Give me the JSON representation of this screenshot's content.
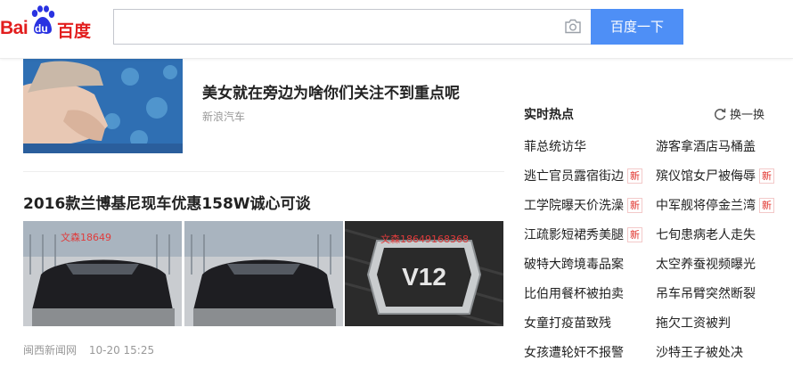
{
  "header": {
    "logo_bai": "Bai",
    "logo_du": "du",
    "logo_cn": "百度",
    "search_value": "",
    "search_button": "百度一下",
    "icons": {
      "camera": "camera-icon"
    }
  },
  "feed": {
    "items": [
      {
        "title": "美女就在旁边为啥你们关注不到重点呢",
        "source": "新浪汽车"
      },
      {
        "title": "2016款兰博基尼现车优惠158W诚心可谈",
        "source": "闽西新闻网",
        "time": "10-20 15:25",
        "thumb_overlays": [
          "文森18649",
          "文森18649168368"
        ]
      }
    ]
  },
  "hot": {
    "title": "实时热点",
    "refresh_label": "换一换",
    "badge_text": "新",
    "items": [
      {
        "text": "菲总统访华",
        "badge": false
      },
      {
        "text": "游客拿酒店马桶盖",
        "badge": false
      },
      {
        "text": "逃亡官员露宿街边",
        "badge": true
      },
      {
        "text": "殡仪馆女尸被侮辱",
        "badge": true
      },
      {
        "text": "工学院曝天价洗澡",
        "badge": true
      },
      {
        "text": "中军舰将停金兰湾",
        "badge": true
      },
      {
        "text": "江疏影短裙秀美腿",
        "badge": true
      },
      {
        "text": "七旬患病老人走失",
        "badge": false
      },
      {
        "text": "破特大跨境毒品案",
        "badge": false
      },
      {
        "text": "太空养蚕视频曝光",
        "badge": false
      },
      {
        "text": "比伯用餐杯被拍卖",
        "badge": false
      },
      {
        "text": "吊车吊臂突然断裂",
        "badge": false
      },
      {
        "text": "女童打疫苗致残",
        "badge": false
      },
      {
        "text": "拖欠工资被判",
        "badge": false
      },
      {
        "text": "女孩遭轮奸不报警",
        "badge": false
      },
      {
        "text": "沙特王子被处决",
        "badge": false
      }
    ]
  },
  "colors": {
    "accent": "#4e8ff6",
    "logo_red": "#e21e1e",
    "logo_blue": "#2932e1",
    "badge_red": "#e0332c"
  }
}
